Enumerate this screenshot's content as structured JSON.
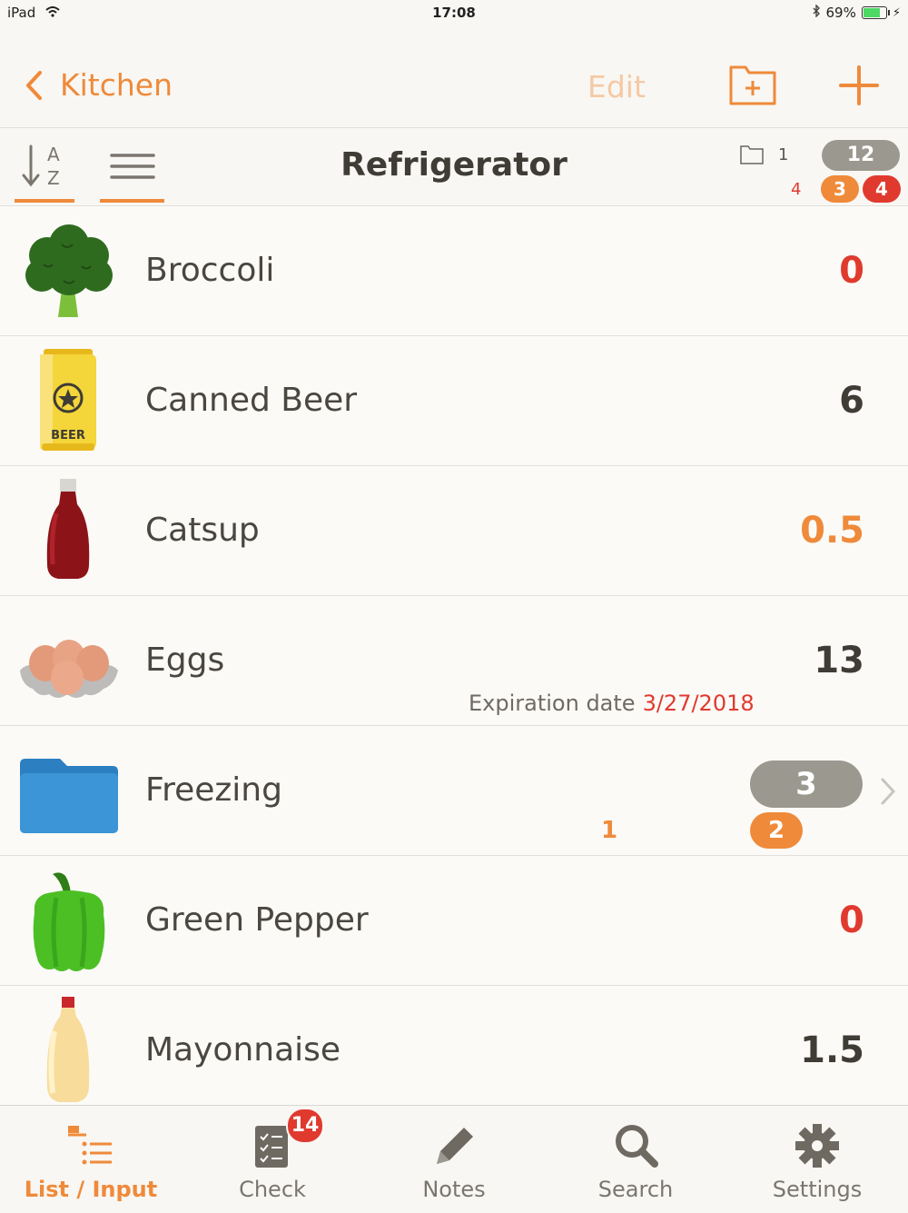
{
  "status_bar": {
    "device": "iPad",
    "time": "17:08",
    "battery": "69%"
  },
  "nav": {
    "back_label": "Kitchen",
    "edit_label": "Edit"
  },
  "toolbar": {
    "title": "Refrigerator",
    "folder_count": "1",
    "total_badge": "12",
    "red_text": "4",
    "orange_badge": "3",
    "red_badge": "4"
  },
  "items": [
    {
      "name": "Broccoli",
      "qty": "0",
      "icon": "broccoli-icon"
    },
    {
      "name": "Canned Beer",
      "qty": "6",
      "icon": "beer-can-icon",
      "label": "BEER"
    },
    {
      "name": "Catsup",
      "qty": "0.5",
      "icon": "ketchup-bottle-icon"
    },
    {
      "name": "Eggs",
      "qty": "13",
      "icon": "eggs-icon",
      "exp_label": "Expiration date",
      "exp_date": "3/27/2018"
    },
    {
      "name": "Freezing",
      "icon": "folder-icon",
      "badge_gray": "3",
      "badge_orange": "2",
      "orange_text": "1"
    },
    {
      "name": "Green Pepper",
      "qty": "0",
      "icon": "green-pepper-icon"
    },
    {
      "name": "Mayonnaise",
      "qty": "1.5",
      "icon": "mayonnaise-icon"
    }
  ],
  "tabs": [
    {
      "label": "List / Input",
      "icon": "list-icon"
    },
    {
      "label": "Check",
      "icon": "checklist-icon",
      "badge": "14"
    },
    {
      "label": "Notes",
      "icon": "pencil-icon"
    },
    {
      "label": "Search",
      "icon": "search-icon"
    },
    {
      "label": "Settings",
      "icon": "gear-icon"
    }
  ],
  "colors": {
    "accent": "#ef8a3a",
    "alert": "#e03a2f",
    "gray_badge": "#9b988f"
  }
}
